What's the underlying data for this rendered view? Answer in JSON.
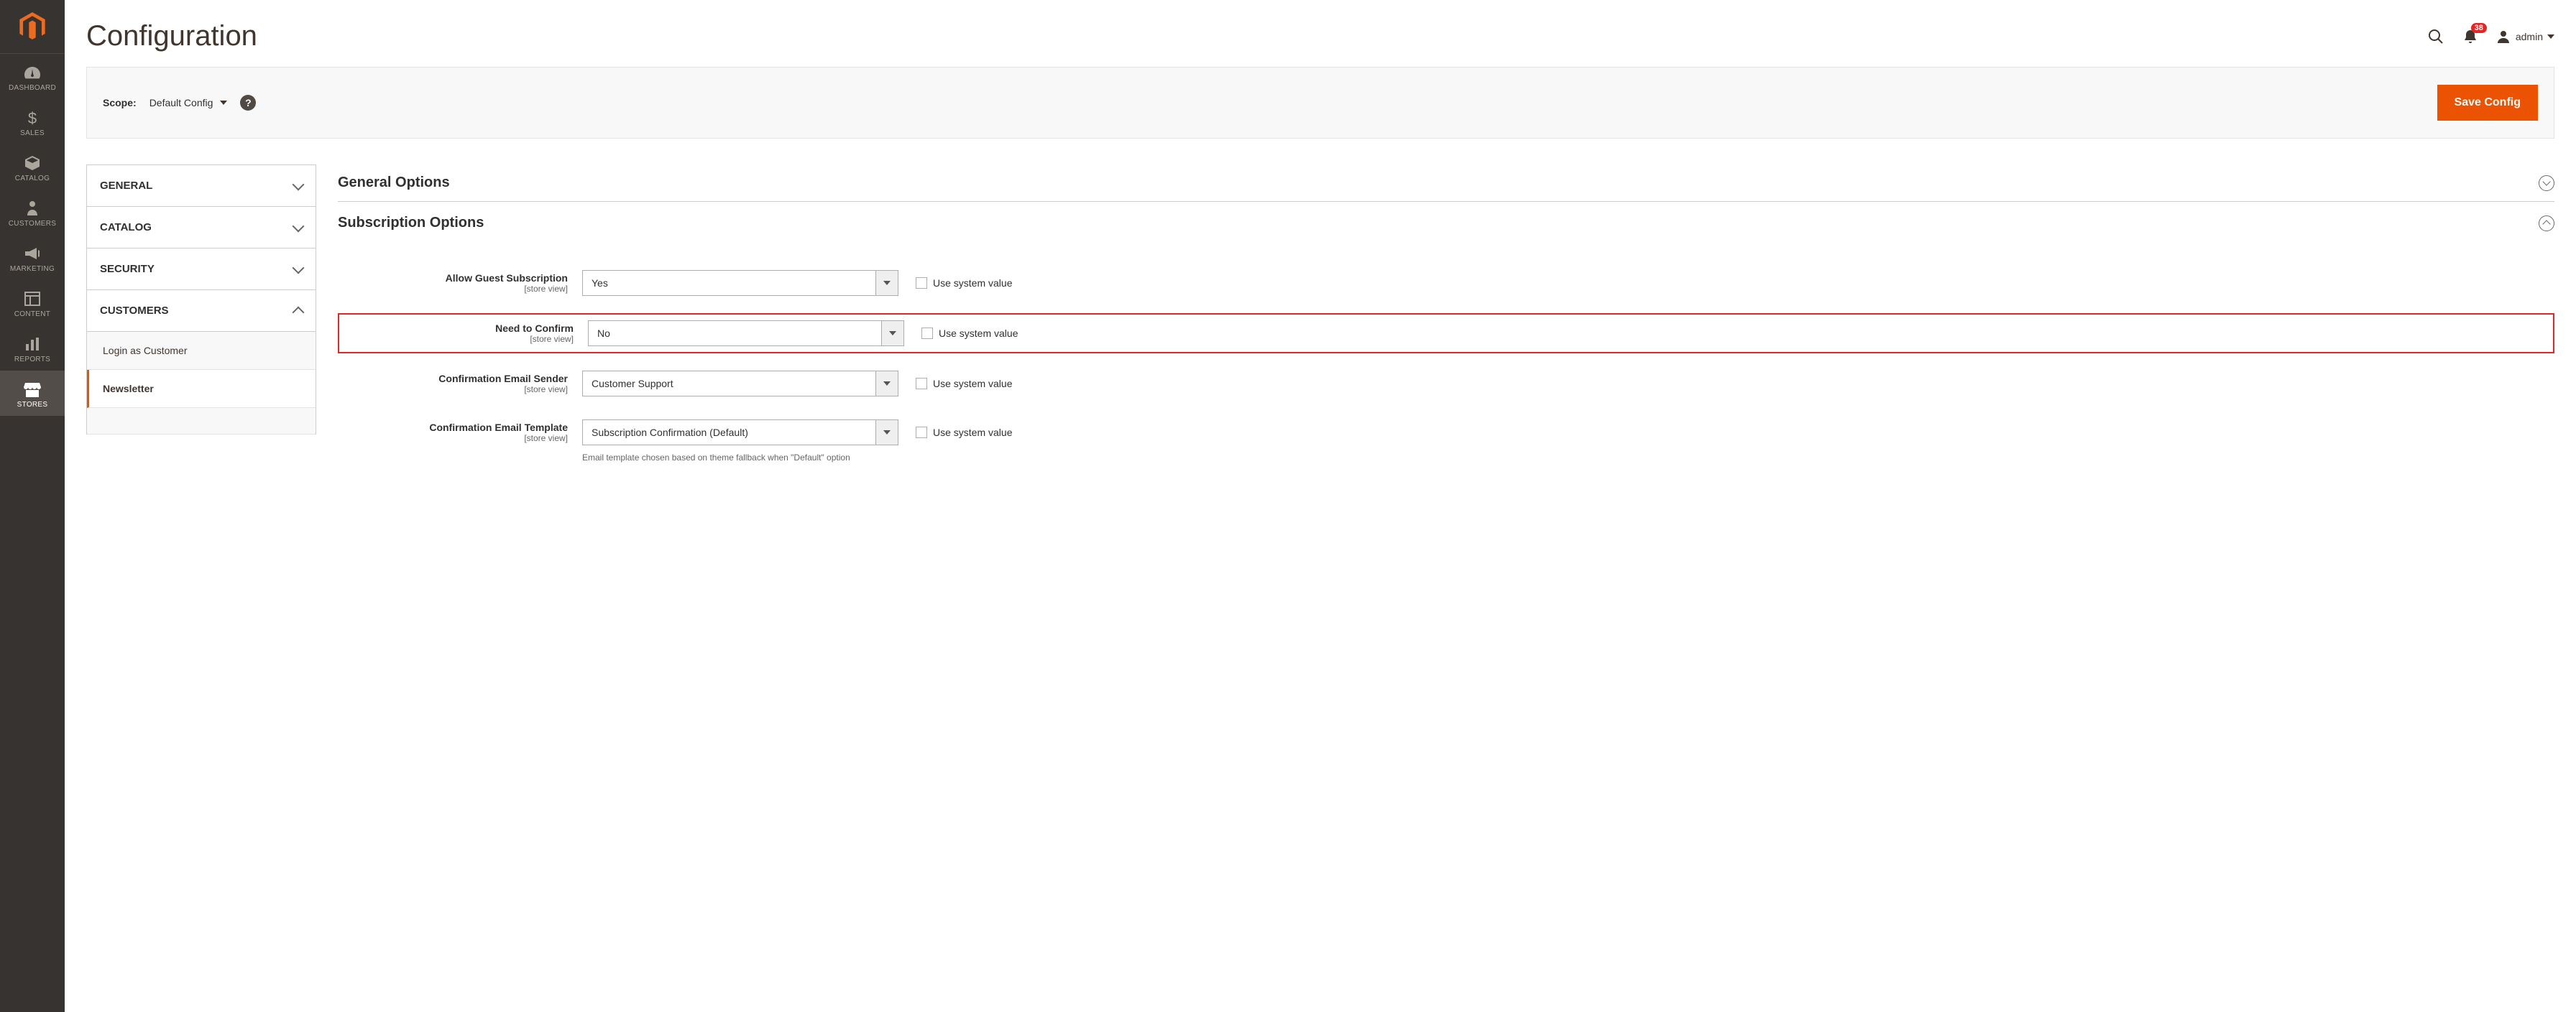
{
  "page_title": "Configuration",
  "header": {
    "notif_count": "38",
    "user_label": "admin"
  },
  "scope": {
    "label": "Scope:",
    "value": "Default Config"
  },
  "save_button": "Save Config",
  "sidebar": {
    "items": [
      {
        "label": "DASHBOARD"
      },
      {
        "label": "SALES"
      },
      {
        "label": "CATALOG"
      },
      {
        "label": "CUSTOMERS"
      },
      {
        "label": "MARKETING"
      },
      {
        "label": "CONTENT"
      },
      {
        "label": "REPORTS"
      },
      {
        "label": "STORES"
      }
    ]
  },
  "cfg_tabs": {
    "general": "GENERAL",
    "catalog": "CATALOG",
    "security": "SECURITY",
    "customers": "CUSTOMERS",
    "sub_login": "Login as Customer",
    "sub_newsletter": "Newsletter"
  },
  "sections": {
    "general": "General Options",
    "subscription": "Subscription Options"
  },
  "fields": {
    "store_view": "[store view]",
    "use_system": "Use system value",
    "allow_guest": {
      "label": "Allow Guest Subscription",
      "value": "Yes"
    },
    "need_confirm": {
      "label": "Need to Confirm",
      "value": "No"
    },
    "conf_sender": {
      "label": "Confirmation Email Sender",
      "value": "Customer Support"
    },
    "conf_template": {
      "label": "Confirmation Email Template",
      "value": "Subscription Confirmation (Default)"
    },
    "template_hint": "Email template chosen based on theme fallback when \"Default\" option"
  }
}
